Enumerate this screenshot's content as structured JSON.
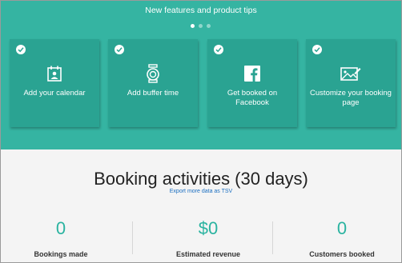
{
  "banner": {
    "title": "New features and product tips",
    "pager": {
      "count": 3,
      "active_index": 0
    }
  },
  "cards": [
    {
      "label": "Add your calendar",
      "icon": "calendar-person-icon",
      "completed": true
    },
    {
      "label": "Add buffer time",
      "icon": "timer-icon",
      "completed": true
    },
    {
      "label": "Get booked on Facebook",
      "icon": "facebook-icon",
      "completed": true
    },
    {
      "label": "Customize your booking page",
      "icon": "image-edit-icon",
      "completed": true
    }
  ],
  "activities": {
    "title": "Booking activities (30 days)",
    "export_link": "Export more data as TSV",
    "stats": [
      {
        "value": "0",
        "label": "Bookings made"
      },
      {
        "value": "$0",
        "label": "Estimated revenue"
      },
      {
        "value": "0",
        "label": "Customers booked"
      }
    ]
  },
  "colors": {
    "banner_bg": "#35b4a2",
    "card_bg": "#2aa392",
    "stat_value": "#2ab3a0",
    "link": "#1b6fc1"
  }
}
